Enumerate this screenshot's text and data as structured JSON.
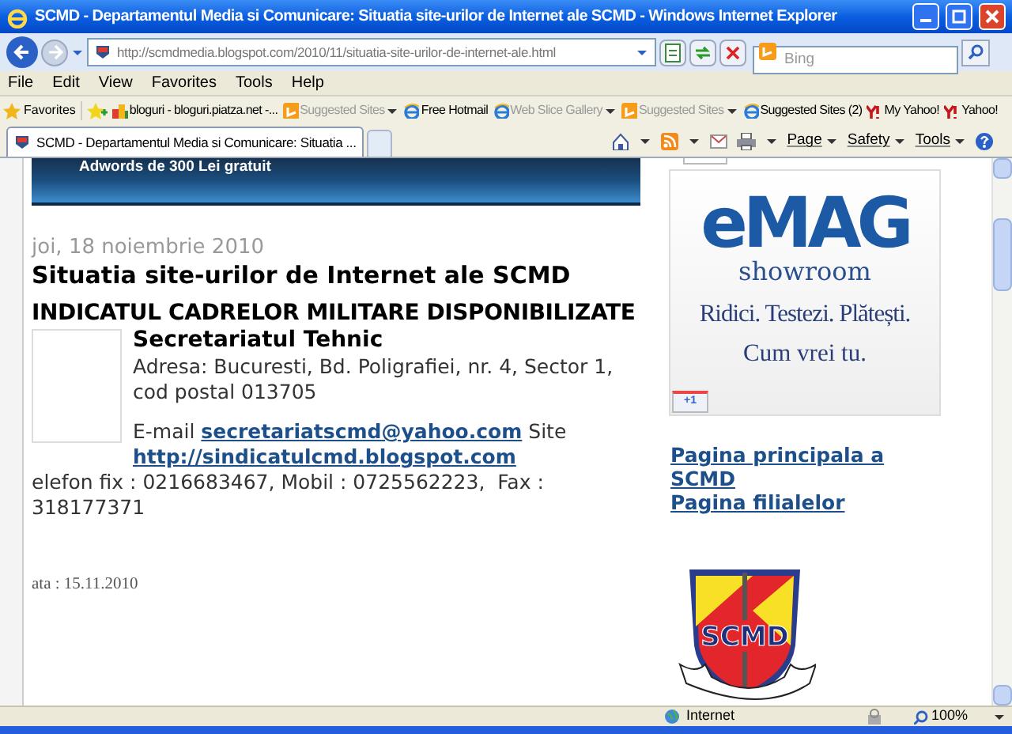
{
  "window": {
    "title": "SCMD - Departamentul Media si Comunicare: Situatia site-urilor de Internet ale SCMD - Windows Internet Explorer"
  },
  "address": {
    "url": "http://scmdmedia.blogspot.com/2010/11/situatia-site-urilor-de-internet-ale.html"
  },
  "search": {
    "placeholder": "Bing"
  },
  "menu": [
    "File",
    "Edit",
    "View",
    "Favorites",
    "Tools",
    "Help"
  ],
  "favorites_label": "Favorites",
  "favorites": [
    {
      "kind": "feed",
      "label": "bloguri - bloguri.piatza.net -...",
      "dimmed": false,
      "caret": false
    },
    {
      "kind": "bing",
      "label": "Suggested Sites",
      "dimmed": true,
      "caret": true
    },
    {
      "kind": "ie",
      "label": "Free Hotmail",
      "dimmed": false,
      "caret": false
    },
    {
      "kind": "ie",
      "label": "Web Slice Gallery",
      "dimmed": true,
      "caret": true
    },
    {
      "kind": "bing",
      "label": "Suggested Sites",
      "dimmed": true,
      "caret": true
    },
    {
      "kind": "ie",
      "label": "Suggested Sites (2)",
      "dimmed": false,
      "caret": false
    },
    {
      "kind": "yahoo",
      "label": "My Yahoo!",
      "dimmed": false,
      "caret": false
    },
    {
      "kind": "yahoo",
      "label": "Yahoo!",
      "dimmed": false,
      "caret": false
    }
  ],
  "tabs": [
    {
      "label": "SCMD - Departamentul Media si Comunicare: Situatia ...",
      "selected": true
    }
  ],
  "command_bar": [
    "Page",
    "Safety",
    "Tools"
  ],
  "banner": {
    "text": "Adwords de 300 Lei gratuit"
  },
  "post": {
    "date": "joi, 18 noiembrie 2010",
    "title": "Situatia site-urilor de Internet ale SCMD",
    "heading": "INDICATUL CADRELOR MILITARE DISPONIBILIZATE",
    "org": "Secretariatul Tehnic",
    "address": "Adresa: Bucuresti, Bd. Poligrafiei, nr. 4, Sector 1, cod postal 013705",
    "email_label": "E-mail",
    "email": "secretariatscmd@yahoo.com",
    "site_label": "Site",
    "site": "http://sindicatulcmd.blogspot.com",
    "phone": "elefon fix : 0216683467, Mobil : 0725562223,  Fax : 318177371",
    "footer": "ata : 15.11.2010"
  },
  "sidebar": {
    "ad": {
      "logo": "eMAG",
      "line1": "showroom",
      "line2": "Ridici. Testezi. Plătești.",
      "line3": "Cum vrei tu.",
      "plus": "+1"
    },
    "links": [
      "Pagina principala a SCMD",
      "Pagina filialelor"
    ],
    "emblem": "SCMD"
  },
  "status_bar": {
    "zone": "Internet",
    "zoom": "100%"
  }
}
